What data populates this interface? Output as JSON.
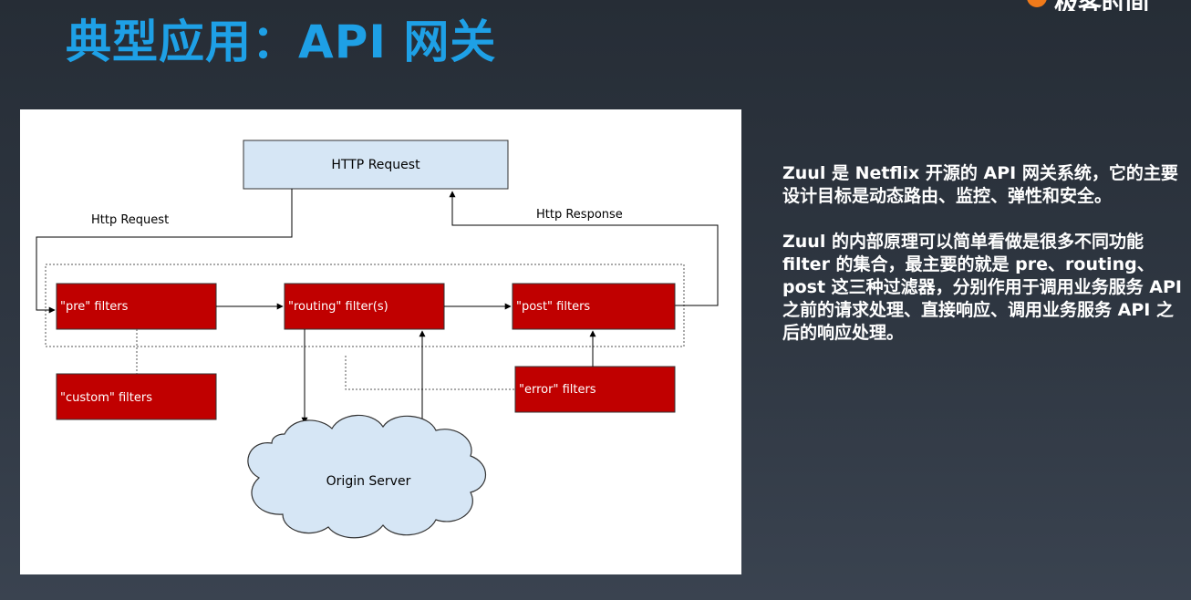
{
  "slide": {
    "title": "典型应用：API 网关",
    "logo_text": "极客时间"
  },
  "diagram": {
    "http_request_box": "HTTP Request",
    "http_request_label": "Http Request",
    "http_response_label": "Http Response",
    "pre_filters": "\"pre\" filters",
    "routing_filters": "\"routing\" filter(s)",
    "post_filters": "\"post\" filters",
    "custom_filters": "\"custom\" filters",
    "error_filters": "\"error\" filters",
    "origin_server": "Origin Server",
    "colors": {
      "filter_box": "#c00000",
      "request_box": "#d6e6f5",
      "cloud": "#d6e6f5"
    }
  },
  "side_text": {
    "paragraph_1": "Zuul 是 Netflix 开源的 API 网关系统，它的主要设计目标是动态路由、监控、弹性和安全。",
    "paragraph_2": "Zuul 的内部原理可以简单看做是很多不同功能 filter 的集合，最主要的就是 pre、routing、post 这三种过滤器，分别作用于调用业务服务 API 之前的请求处理、直接响应、调用业务服务 API 之后的响应处理。"
  },
  "colors": {
    "title": "#1ea0e6",
    "background": "#2b333d"
  }
}
